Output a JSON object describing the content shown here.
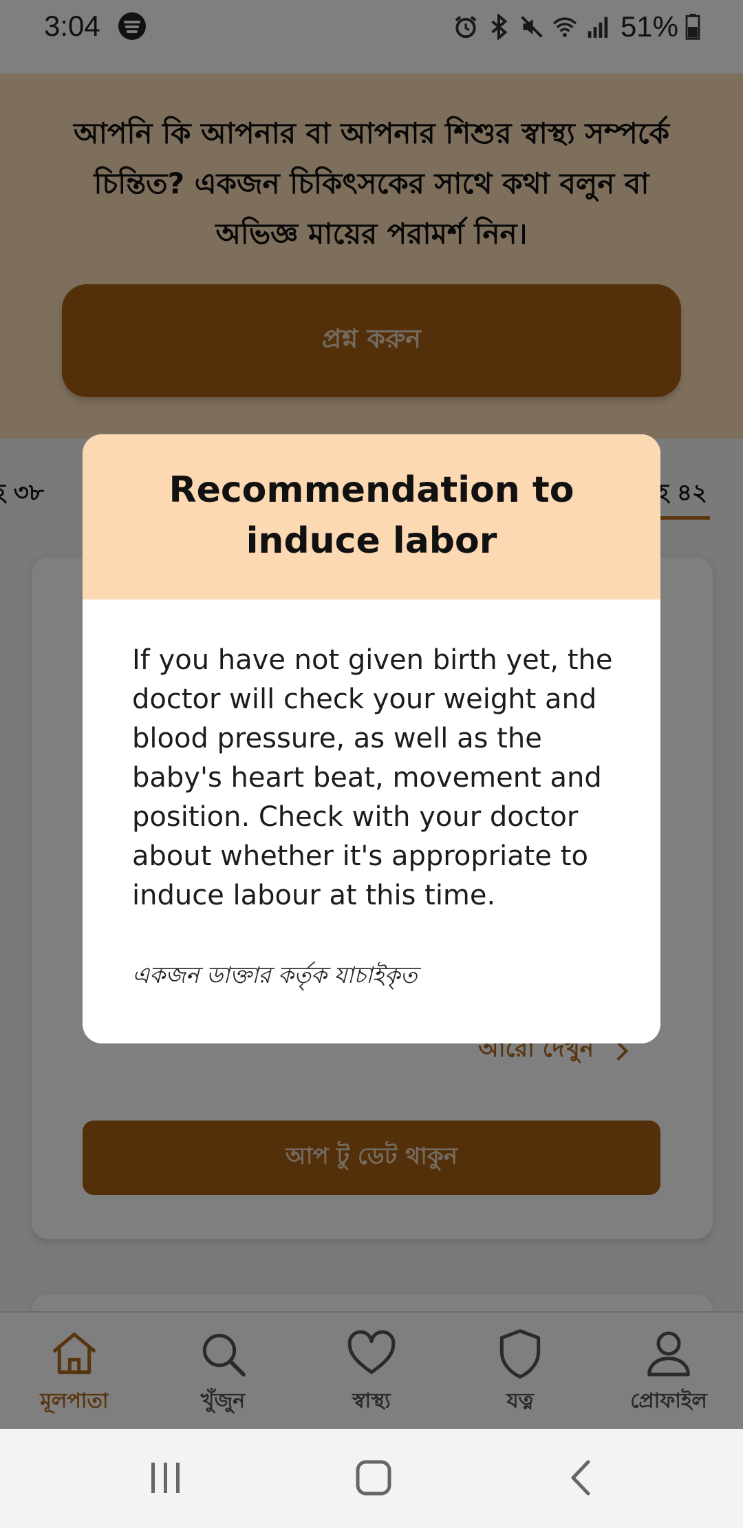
{
  "status_bar": {
    "time": "3:04",
    "battery": "51%",
    "icons": [
      "spotify-icon",
      "alarm-icon",
      "bluetooth-icon",
      "mute-icon",
      "wifi-icon",
      "signal-icon",
      "battery-icon"
    ]
  },
  "banner": {
    "text": "আপনি কি আপনার বা আপনার শিশুর স্বাস্থ্য সম্পর্কে চিন্তিত? একজন চিকিৎসকের সাথে কথা বলুন বা অভিজ্ঞ মায়ের পরামর্শ নিন।",
    "button_label": "প্রশ্ন করুন"
  },
  "tabs": {
    "left_label": "হ ৩৮",
    "right_label": "হ ৪২"
  },
  "card": {
    "see_more_label": "আরো দেখুন",
    "uptodate_label": "আপ টু ডেট থাকুন"
  },
  "modal": {
    "title": "Recommendation to induce labor",
    "body": "If you have not given birth yet, the doctor will check your weight and blood pressure, as well as the baby's heart beat, movement and position. Check with your doctor about whether it's appropriate to induce labour at this time.",
    "verified": "একজন ডাক্তার কর্তৃক যাচাইকৃত"
  },
  "bottom_nav": {
    "items": [
      {
        "label": "মূলপাতা",
        "icon": "home-icon",
        "active": true
      },
      {
        "label": "খুঁজুন",
        "icon": "search-icon",
        "active": false
      },
      {
        "label": "স্বাস্থ্য",
        "icon": "heart-icon",
        "active": false
      },
      {
        "label": "যত্ন",
        "icon": "shield-icon",
        "active": false
      },
      {
        "label": "প্রোফাইল",
        "icon": "profile-icon",
        "active": false
      }
    ]
  },
  "colors": {
    "brand": "#a86015",
    "accent": "#b06a1e",
    "banner_bg": "#fddfb9",
    "modal_header_bg": "#fdd9b3"
  }
}
